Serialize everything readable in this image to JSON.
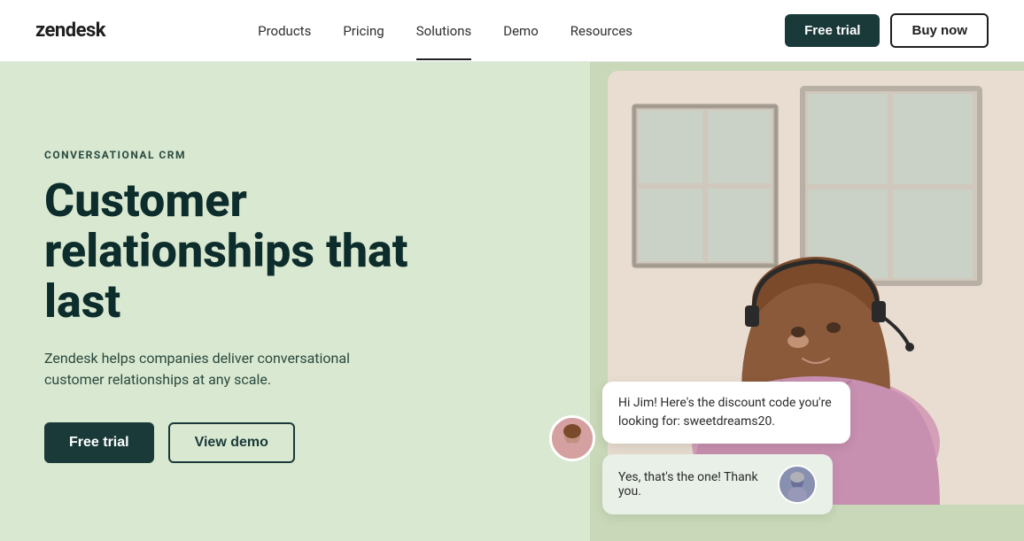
{
  "header": {
    "logo": "zendesk",
    "nav_items": [
      {
        "label": "Products",
        "active": false
      },
      {
        "label": "Pricing",
        "active": false
      },
      {
        "label": "Solutions",
        "active": true
      },
      {
        "label": "Demo",
        "active": false
      },
      {
        "label": "Resources",
        "active": false
      }
    ],
    "free_trial_label": "Free trial",
    "buy_now_label": "Buy now"
  },
  "hero": {
    "eyebrow": "CONVERSATIONAL CRM",
    "headline": "Customer relationships that last",
    "subtext": "Zendesk helps companies deliver conversational customer relationships at any scale.",
    "free_trial_label": "Free trial",
    "view_demo_label": "View demo",
    "chat_bubble_agent": "Hi Jim! Here's the discount code you're looking for: sweetdreams20.",
    "chat_bubble_user": "Yes, that's the one! Thank you."
  }
}
